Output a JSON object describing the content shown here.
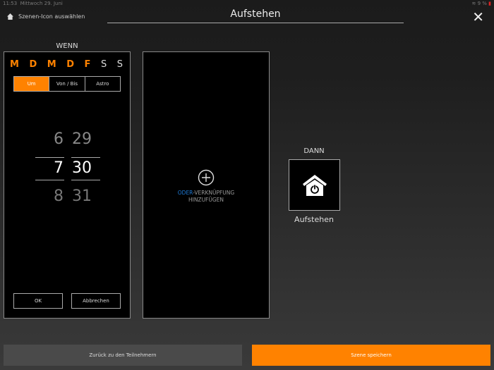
{
  "status": {
    "time": "11:53",
    "date": "Mittwoch 29. Juni",
    "battery": "9 %"
  },
  "header": {
    "icon_select": "Szenen-Icon auswählen",
    "title": "Aufstehen"
  },
  "wenn": {
    "label": "WENN",
    "days": [
      {
        "l": "M",
        "on": true
      },
      {
        "l": "D",
        "on": true
      },
      {
        "l": "M",
        "on": true
      },
      {
        "l": "D",
        "on": true
      },
      {
        "l": "F",
        "on": true
      },
      {
        "l": "S",
        "on": false
      },
      {
        "l": "S",
        "on": false
      }
    ],
    "modes": [
      "Um",
      "Von / Bis",
      "Astro"
    ],
    "hours": [
      "6",
      "7",
      "8"
    ],
    "minutes": [
      "29",
      "30",
      "31"
    ],
    "ok": "OK",
    "cancel": "Abbrechen"
  },
  "oder": {
    "highlight": "ODER",
    "rest": "-VERKNÜPFUNG",
    "line2": "HINZUFÜGEN"
  },
  "dann": {
    "label": "DANN",
    "scene": "Aufstehen"
  },
  "footer": {
    "back": "Zurück zu den Teilnehmern",
    "save": "Szene speichern"
  },
  "colors": {
    "accent": "#ff8200",
    "link": "#1e7bd8"
  }
}
